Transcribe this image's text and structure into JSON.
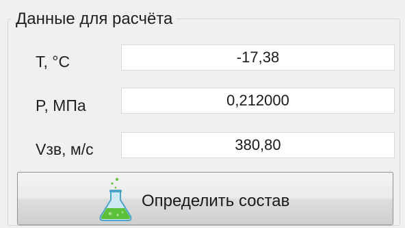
{
  "group": {
    "title": "Данные для расчёта"
  },
  "fields": [
    {
      "label": "T, °C",
      "value": "-17,38"
    },
    {
      "label": "P, МПа",
      "value": "0,212000"
    },
    {
      "label": "Vзв, м/с",
      "value": "380,80"
    }
  ],
  "button": {
    "label": "Определить состав",
    "icon": "flask-icon"
  },
  "colors": {
    "flask_liquid": "#5cbf3a",
    "flask_glass": "#4aa3c8"
  }
}
